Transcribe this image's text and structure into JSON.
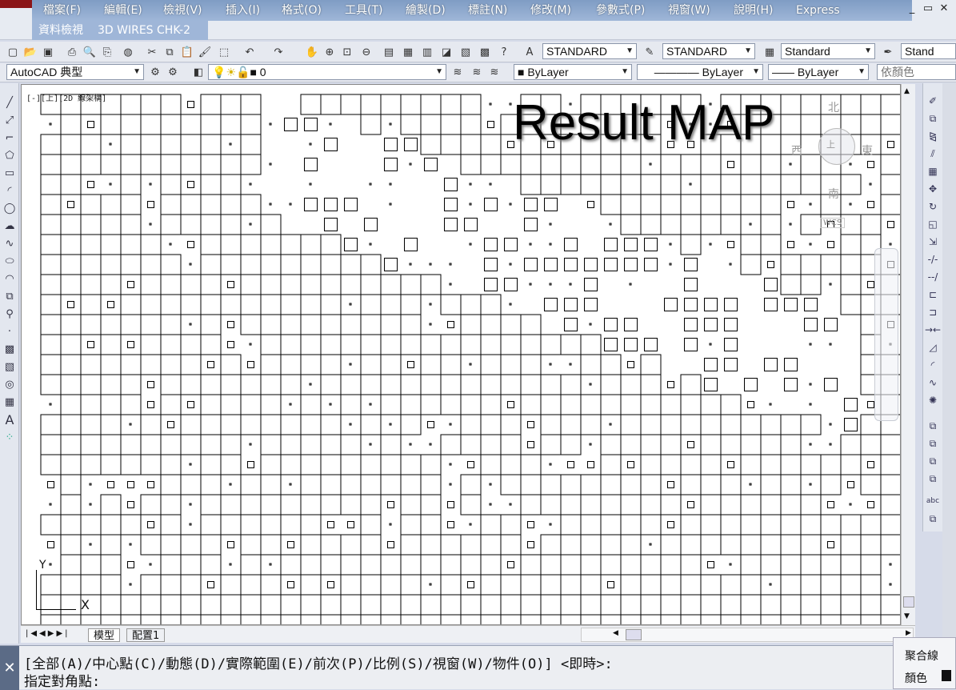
{
  "menu": {
    "items": [
      "檔案(F)",
      "編輯(E)",
      "檢視(V)",
      "插入(I)",
      "格式(O)",
      "工具(T)",
      "繪製(D)",
      "標註(N)",
      "修改(M)",
      "參數式(P)",
      "視窗(W)",
      "說明(H)",
      "Express"
    ],
    "window_buttons": [
      "_",
      "▭",
      "✕"
    ]
  },
  "subtitle": {
    "left": "資料檢視",
    "right": "3D WIRES CHK-2"
  },
  "toolbar1": {
    "text_style": "STANDARD",
    "dim_style": "STANDARD",
    "table_style": "Standard",
    "multileader_style": "Stand"
  },
  "toolbar2": {
    "workspace": "AutoCAD 典型",
    "layer": "0",
    "color": "ByLayer",
    "linetype": "ByLayer",
    "lineweight": "ByLayer",
    "plot_style": "依顏色"
  },
  "drawing": {
    "viewport_label": "[-][上][2D 線架構]",
    "title": "Result MAP",
    "viewcube": {
      "north": "北",
      "south": "南",
      "east": "東",
      "west": "西",
      "wcs": "WCS"
    },
    "ucs": {
      "x": "X",
      "y": "Y"
    },
    "grid": {
      "cols": 43,
      "rows": 27,
      "filled_ratio": 0.78
    }
  },
  "tabs": [
    "模型",
    "配置1"
  ],
  "command": {
    "line1": "[全部(A)/中心點(C)/動態(D)/實際範圍(E)/前次(P)/比例(S)/視窗(W)/物件(O)] <即時>:",
    "line2": "指定對角點:"
  },
  "properties_panel": {
    "title": "聚合線",
    "color_label": "顏色"
  }
}
